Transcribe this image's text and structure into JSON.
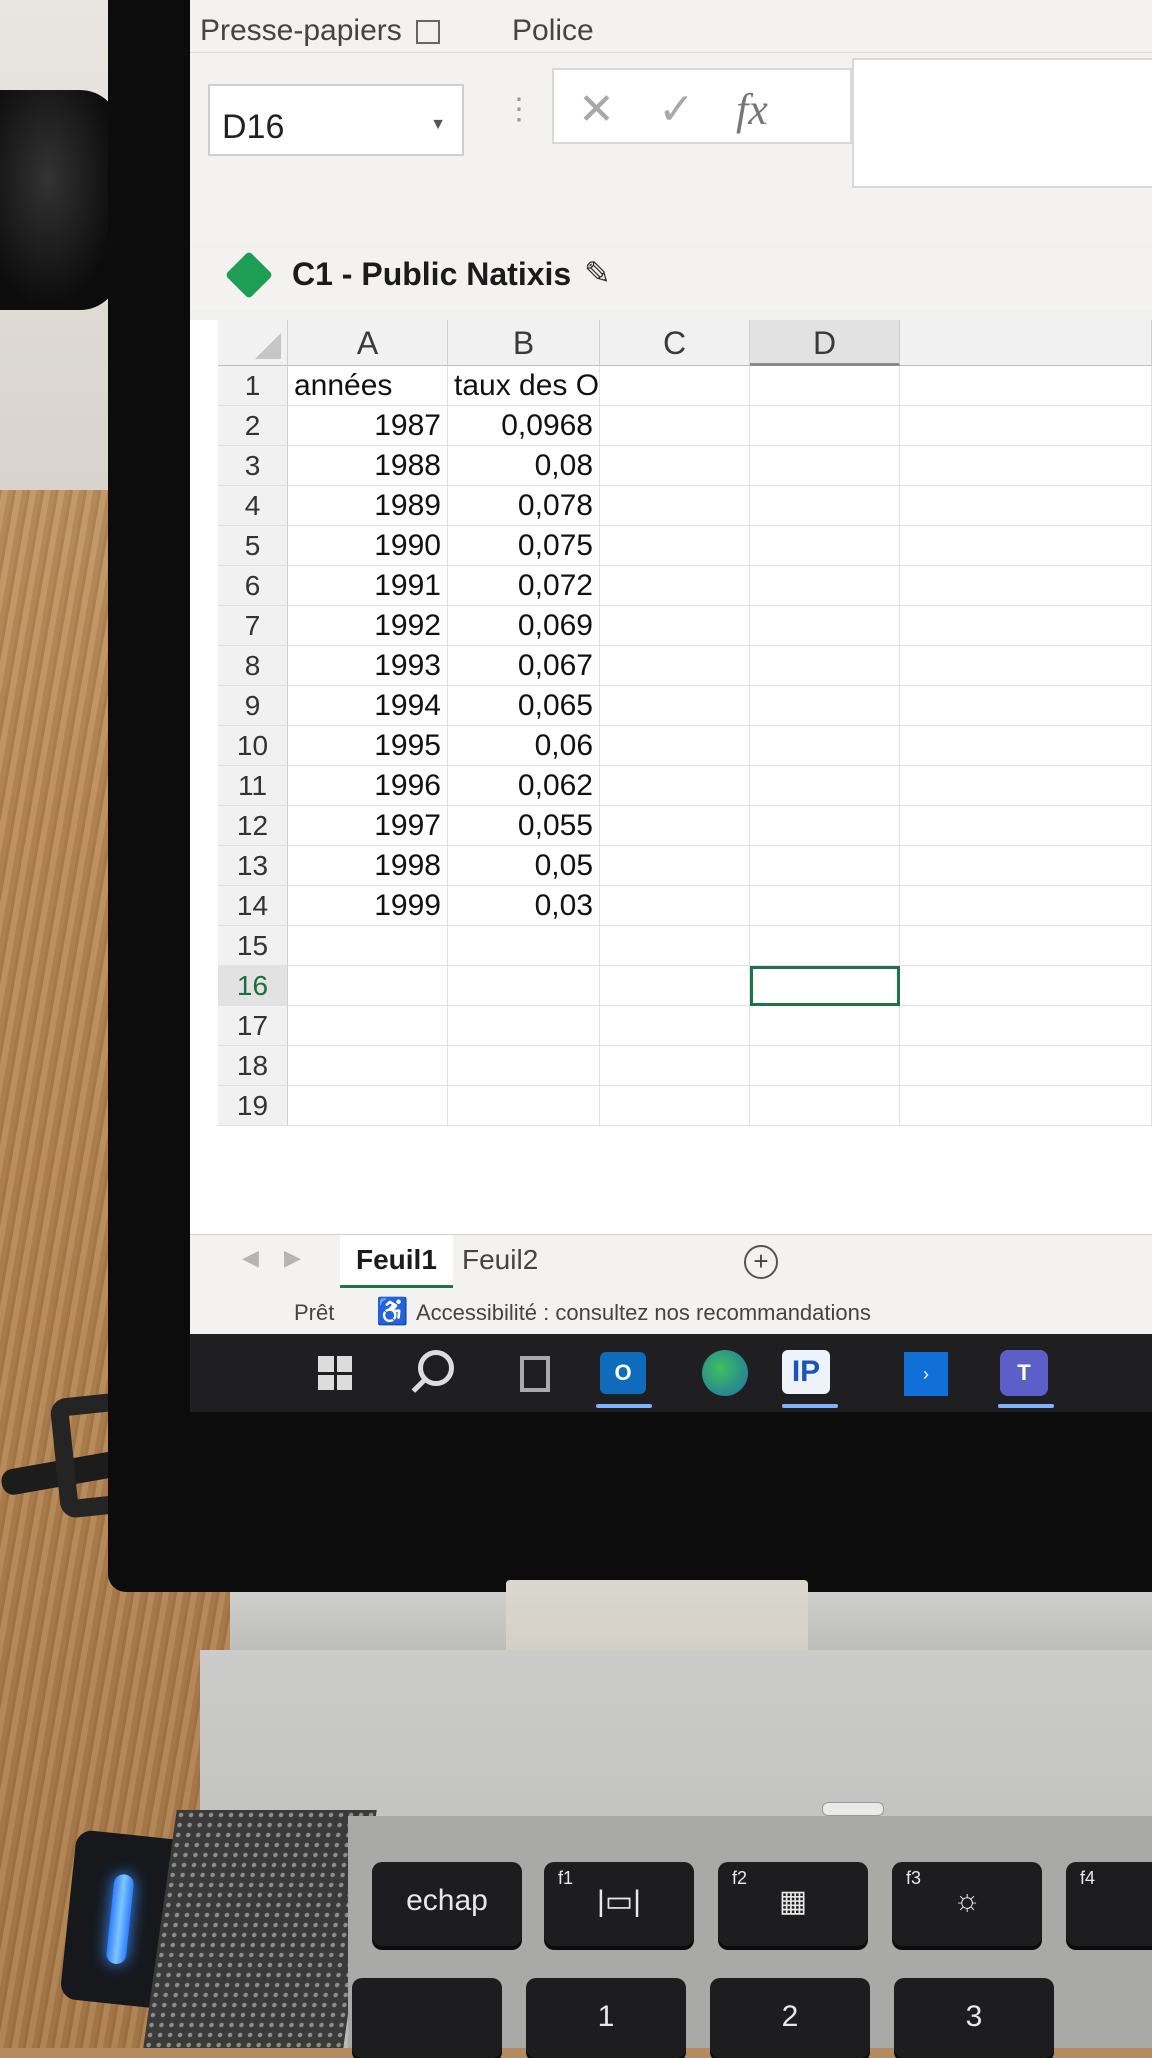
{
  "ribbon": {
    "group_clipboard": "Presse-papiers",
    "group_font": "Police",
    "name_box": "D16",
    "cancel_glyph": "✕",
    "confirm_glyph": "✓",
    "fx_label": "fx"
  },
  "sensitivity_label": "C1 - Public Natixis",
  "grid": {
    "columns": [
      "A",
      "B",
      "C",
      "D"
    ],
    "rows": [
      {
        "n": "1",
        "a": "années",
        "b": "taux des OAT"
      },
      {
        "n": "2",
        "a": "1987",
        "b": "0,0968"
      },
      {
        "n": "3",
        "a": "1988",
        "b": "0,08"
      },
      {
        "n": "4",
        "a": "1989",
        "b": "0,078"
      },
      {
        "n": "5",
        "a": "1990",
        "b": "0,075"
      },
      {
        "n": "6",
        "a": "1991",
        "b": "0,072"
      },
      {
        "n": "7",
        "a": "1992",
        "b": "0,069"
      },
      {
        "n": "8",
        "a": "1993",
        "b": "0,067"
      },
      {
        "n": "9",
        "a": "1994",
        "b": "0,065"
      },
      {
        "n": "10",
        "a": "1995",
        "b": "0,06"
      },
      {
        "n": "11",
        "a": "1996",
        "b": "0,062"
      },
      {
        "n": "12",
        "a": "1997",
        "b": "0,055"
      },
      {
        "n": "13",
        "a": "1998",
        "b": "0,05"
      },
      {
        "n": "14",
        "a": "1999",
        "b": "0,03"
      },
      {
        "n": "15",
        "a": "",
        "b": ""
      },
      {
        "n": "16",
        "a": "",
        "b": ""
      },
      {
        "n": "17",
        "a": "",
        "b": ""
      },
      {
        "n": "18",
        "a": "",
        "b": ""
      },
      {
        "n": "19",
        "a": "",
        "b": ""
      }
    ],
    "active_cell": "D16"
  },
  "sheets": {
    "tabs": [
      "Feuil1",
      "Feuil2"
    ],
    "active": "Feuil1",
    "add_glyph": "+"
  },
  "status": {
    "ready": "Prêt",
    "accessibility": "Accessibilité : consultez nos recommandations"
  },
  "taskbar": {
    "outlook_glyph": "O",
    "ip_glyph": "IP",
    "teams_glyph": "T",
    "blue_glyph": "›"
  },
  "keyboard": {
    "esc": "echap",
    "f1": "f1",
    "f2": "f2",
    "f3": "f3",
    "f4": "f4",
    "k1": "1",
    "k2": "2",
    "k3": "3"
  },
  "colors": {
    "excel_green": "#217346",
    "tag_green": "#1e9e54",
    "taskbar": "#1f1f22"
  }
}
